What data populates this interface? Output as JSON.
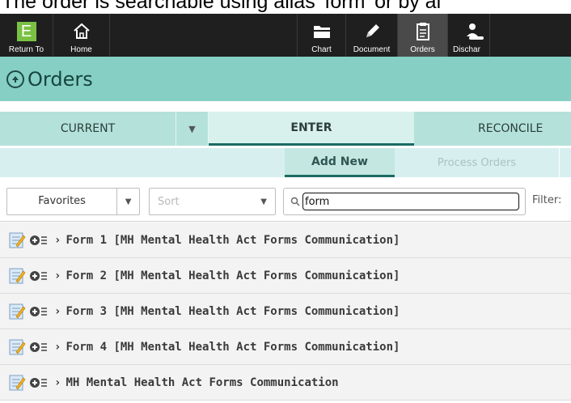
{
  "caption": "The order is searchable using alias 'form' or by al",
  "toolbar": {
    "return_label": "Return To",
    "return_logo": "E",
    "home_label": "Home",
    "chart_label": "Chart",
    "document_label": "Document",
    "orders_label": "Orders",
    "discharge_label": "Dischar"
  },
  "header": {
    "title": "Orders"
  },
  "tabs": {
    "current": "CURRENT",
    "enter": "ENTER",
    "reconcile": "RECONCILE"
  },
  "subtabs": {
    "add_new": "Add New",
    "process_orders": "Process Orders"
  },
  "filters": {
    "favorites": "Favorites",
    "sort_placeholder": "Sort",
    "search_value": "form",
    "filter_label": "Filter:"
  },
  "rows": [
    "Form 1 [MH Mental Health Act Forms Communication]",
    "Form 2 [MH Mental Health Act Forms Communication]",
    "Form 3 [MH Mental Health Act Forms Communication]",
    "Form 4 [MH Mental Health Act Forms Communication]",
    "MH Mental Health Act Forms Communication"
  ],
  "colors": {
    "toolbar": "#1f1f1f",
    "header": "#86cfc4",
    "tabs": "#b4e2da",
    "accent": "#1a6b62"
  }
}
